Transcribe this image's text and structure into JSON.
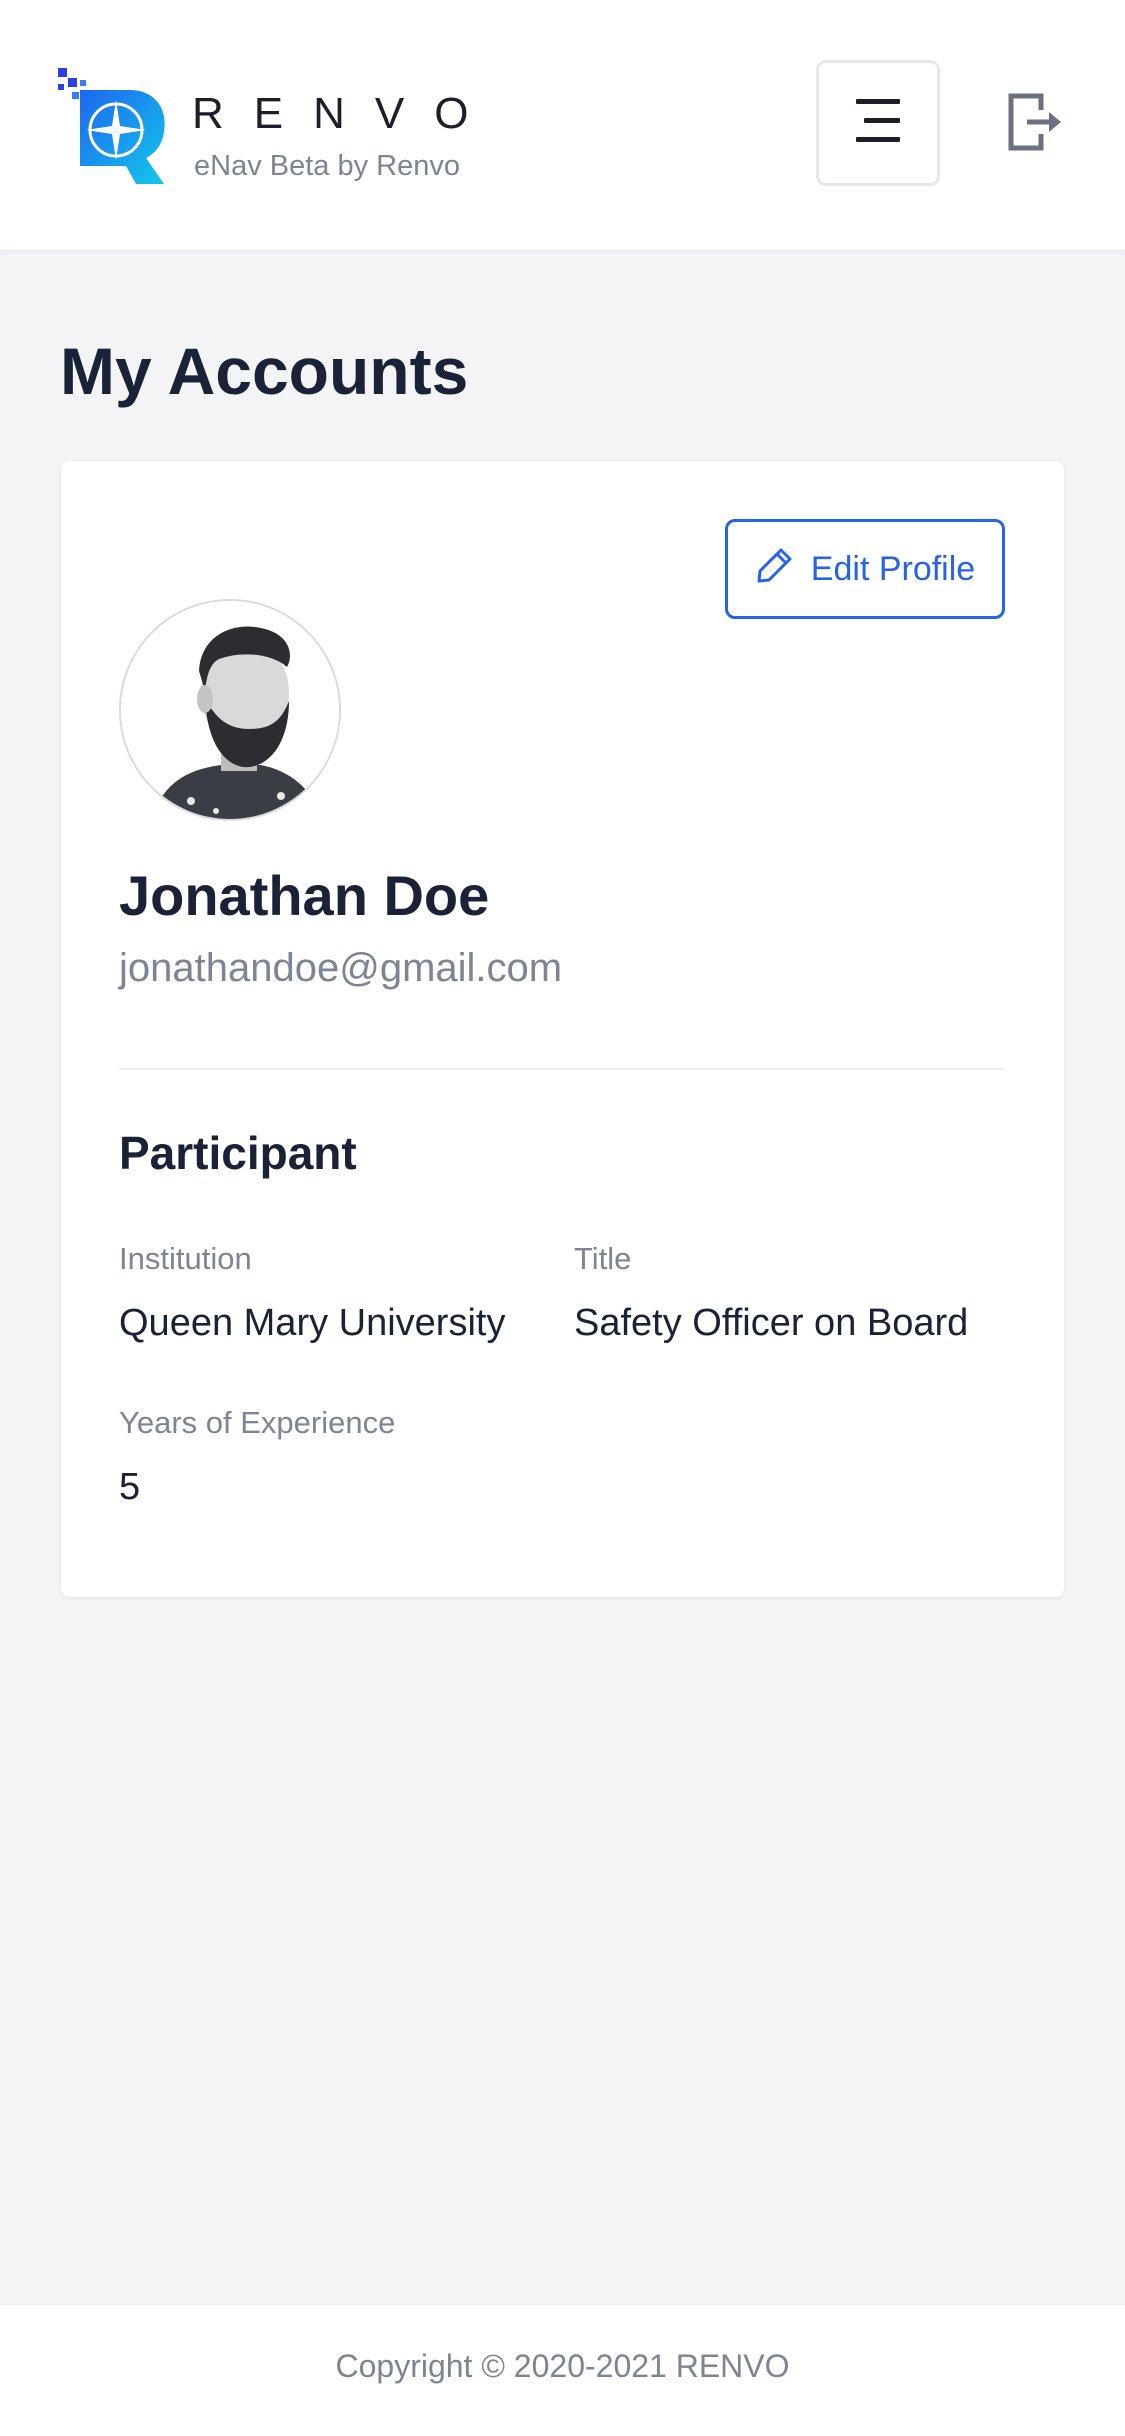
{
  "header": {
    "brand_name": "RENVO",
    "brand_subtitle": "eNav Beta by Renvo",
    "logo_icon": "renvo-compass-logo",
    "menu_icon": "hamburger-menu-icon",
    "logout_icon": "logout-icon"
  },
  "page": {
    "title": "My Accounts"
  },
  "profile": {
    "edit_button_label": "Edit Profile",
    "edit_icon": "pencil-icon",
    "name": "Jonathan Doe",
    "email": "jonathandoe@gmail.com",
    "avatar_icon": "user-avatar"
  },
  "participant": {
    "section_title": "Participant",
    "institution_label": "Institution",
    "institution_value": "Queen Mary University",
    "title_label": "Title",
    "title_value": "Safety Officer on Board",
    "experience_label": "Years of Experience",
    "experience_value": "5"
  },
  "footer": {
    "copyright": "Copyright © 2020-2021 RENVO"
  },
  "colors": {
    "accent": "#2563eb",
    "background": "#f3f4f6",
    "text_primary": "#1a2238",
    "text_secondary": "#7d8494"
  }
}
